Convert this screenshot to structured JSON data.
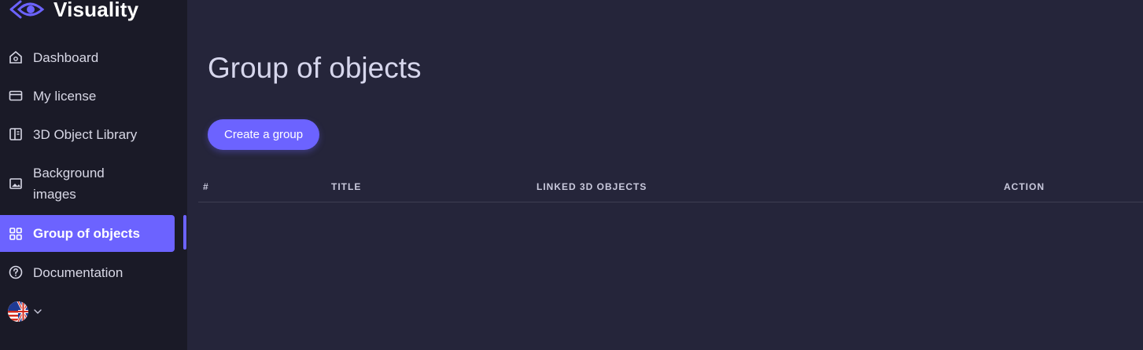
{
  "brand": {
    "name": "Visuality",
    "accent": "#6c63ff"
  },
  "sidebar": {
    "items": [
      {
        "label": "Dashboard",
        "icon": "home-icon"
      },
      {
        "label": "My license",
        "icon": "credit-card-icon"
      },
      {
        "label": "3D Object Library",
        "icon": "book-icon"
      },
      {
        "label": "Background images",
        "icon": "image-icon"
      },
      {
        "label": "Group of objects",
        "icon": "grid-icon",
        "active": true
      },
      {
        "label": "Documentation",
        "icon": "help-circle-icon"
      }
    ],
    "language": {
      "icon": "uk-us-flag-icon",
      "dropdown_icon": "chevron-down-icon"
    }
  },
  "main": {
    "title": "Group of objects",
    "create_button_label": "Create a group",
    "table": {
      "columns": [
        "#",
        "TITLE",
        "LINKED 3D OBJECTS",
        "ACTION"
      ],
      "rows": []
    }
  },
  "colors": {
    "sidebar_bg": "#1a1a27",
    "main_bg": "#25253a",
    "accent": "#6c63ff"
  }
}
